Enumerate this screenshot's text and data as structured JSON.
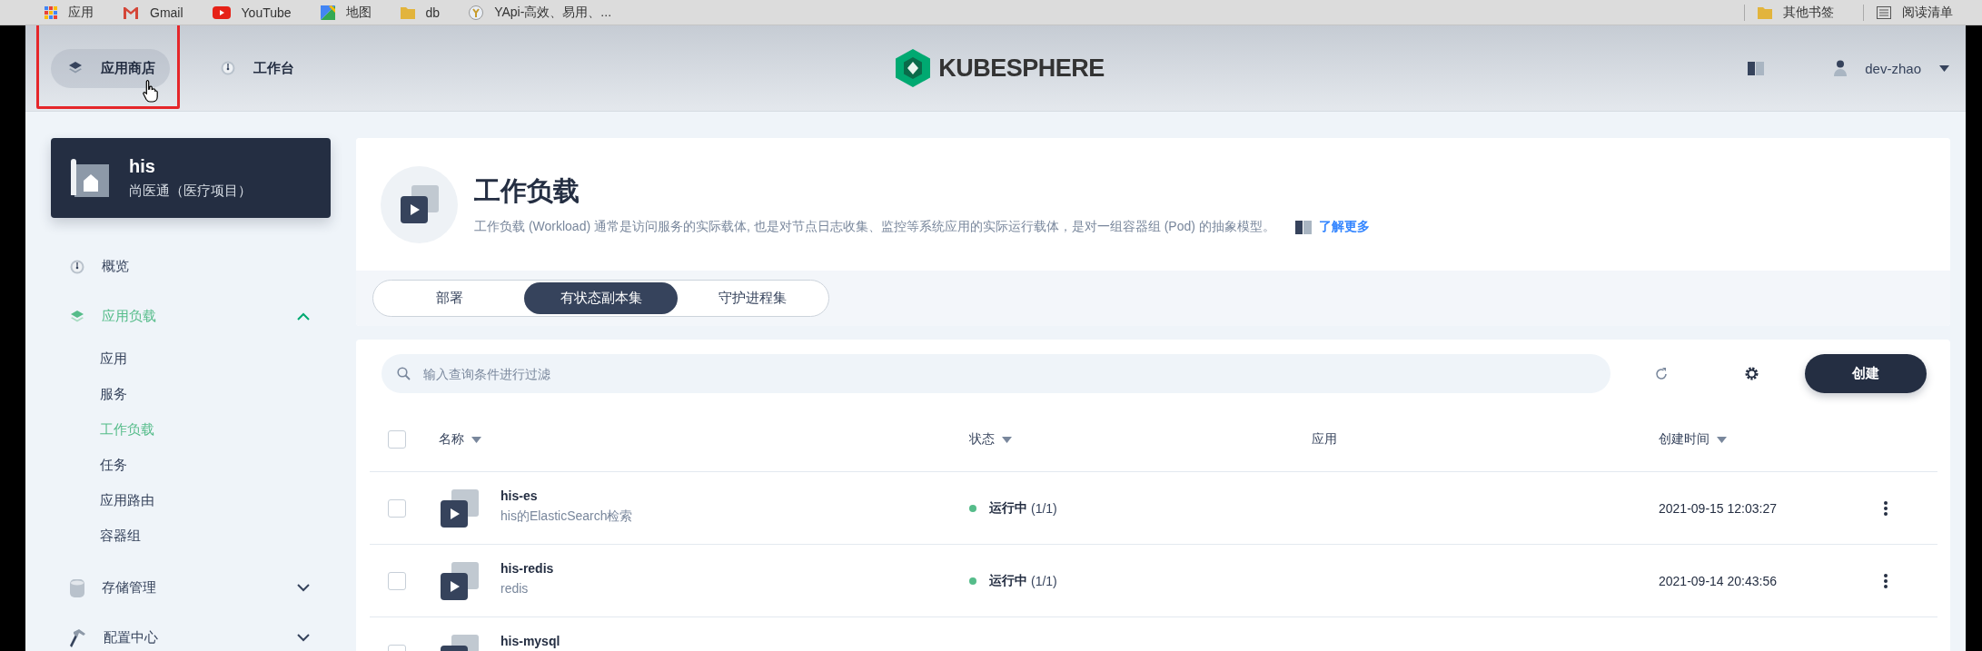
{
  "bookmarks": {
    "items": [
      {
        "label": "应用"
      },
      {
        "label": "Gmail"
      },
      {
        "label": "YouTube"
      },
      {
        "label": "地图"
      },
      {
        "label": "db"
      },
      {
        "label": "YApi-高效、易用、..."
      }
    ],
    "right": [
      {
        "label": "其他书签"
      },
      {
        "label": "阅读清单"
      }
    ]
  },
  "top_nav": {
    "items": [
      {
        "label": "应用商店",
        "hovered": true,
        "highlighted": true
      },
      {
        "label": "工作台",
        "hovered": false,
        "highlighted": false
      }
    ],
    "logo": "KUBESPHERE",
    "user": "dev-zhao"
  },
  "sidebar": {
    "project": {
      "name": "his",
      "description": "尚医通（医疗项目）"
    },
    "items": [
      {
        "label": "概览",
        "selected": false
      },
      {
        "label": "应用负载",
        "selected": true,
        "expanded": true,
        "children": [
          {
            "label": "应用",
            "selected": false
          },
          {
            "label": "服务",
            "selected": false
          },
          {
            "label": "工作负载",
            "selected": true
          },
          {
            "label": "任务",
            "selected": false
          },
          {
            "label": "应用路由",
            "selected": false
          },
          {
            "label": "容器组",
            "selected": false
          }
        ]
      },
      {
        "label": "存储管理",
        "selected": false,
        "expanded": false
      },
      {
        "label": "配置中心",
        "selected": false,
        "expanded": false
      }
    ]
  },
  "page_header": {
    "title": "工作负载",
    "description": "工作负载 (Workload) 通常是访问服务的实际载体, 也是对节点日志收集、监控等系统应用的实际运行载体，是对一组容器组 (Pod) 的抽象模型。",
    "link": "了解更多",
    "tabs": [
      {
        "label": "部署",
        "selected": false
      },
      {
        "label": "有状态副本集",
        "selected": true
      },
      {
        "label": "守护进程集",
        "selected": false
      }
    ]
  },
  "table": {
    "search": {
      "placeholder": "输入查询条件进行过滤"
    },
    "create_button": "创建",
    "select_all": {
      "checked": false
    },
    "columns": [
      {
        "label": "名称",
        "sortable": true
      },
      {
        "label": "状态",
        "sortable": true
      },
      {
        "label": "应用",
        "sortable": false
      },
      {
        "label": "创建时间",
        "sortable": true
      }
    ],
    "rows": [
      {
        "checked": false,
        "name": "his-es",
        "description": "his的ElasticSearch检索",
        "status": "运行中",
        "replicas": "(1/1)",
        "color": "#55bc8a",
        "created": "2021-09-15 12:03:27"
      },
      {
        "checked": false,
        "name": "his-redis",
        "description": "redis",
        "status": "运行中",
        "replicas": "(1/1)",
        "color": "#55bc8a",
        "created": "2021-09-14 20:43:56"
      },
      {
        "checked": false,
        "name": "his-mysql"
      }
    ]
  }
}
